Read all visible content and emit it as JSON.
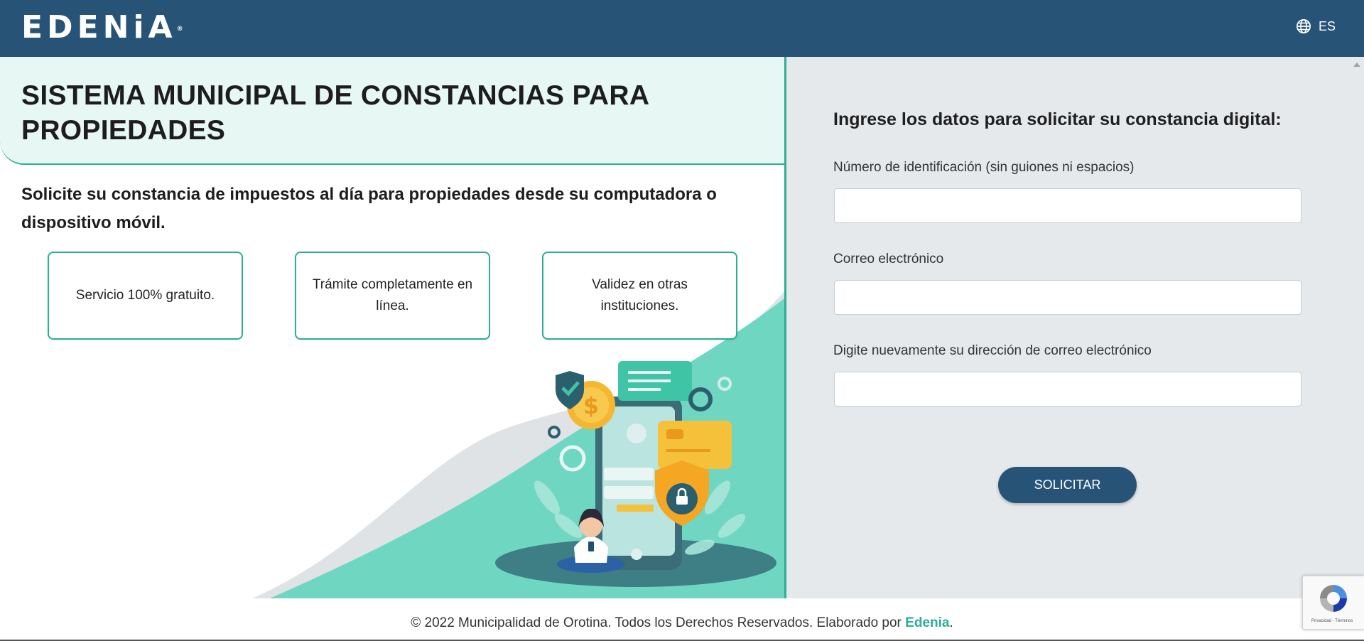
{
  "header": {
    "logo_text": "EDENiA",
    "logo_reg": "®",
    "language": "ES",
    "background_color": "#275377"
  },
  "hero": {
    "title": "SISTEMA MUNICIPAL DE CONSTANCIAS PARA PROPIEDADES",
    "subtitle": "Solicite su constancia de impuestos al día para propiedades desde su computadora o dispositivo móvil.",
    "features": [
      "Servicio 100% gratuito.",
      "Trámite completamente en línea.",
      "Validez en otras instituciones."
    ],
    "accent_color": "#2bae93"
  },
  "form": {
    "heading": "Ingrese los datos para solicitar su constancia digital:",
    "id_label": "Número de identificación (sin guiones ni espacios)",
    "id_value": "",
    "email_label": "Correo electrónico",
    "email_value": "",
    "email_confirm_label": "Digite nuevamente su dirección de correo electrónico",
    "email_confirm_value": "",
    "submit_label": "SOLICITAR"
  },
  "footer": {
    "text": "© 2022 Municipalidad de Orotina. Todos los Derechos Reservados. Elaborado por ",
    "link": "Edenia",
    "suffix": "."
  },
  "recaptcha": {
    "text": "Privacidad - Términos"
  },
  "icons": [
    "globe-icon",
    "recaptcha-icon",
    "scroll-up-arrow-icon"
  ]
}
